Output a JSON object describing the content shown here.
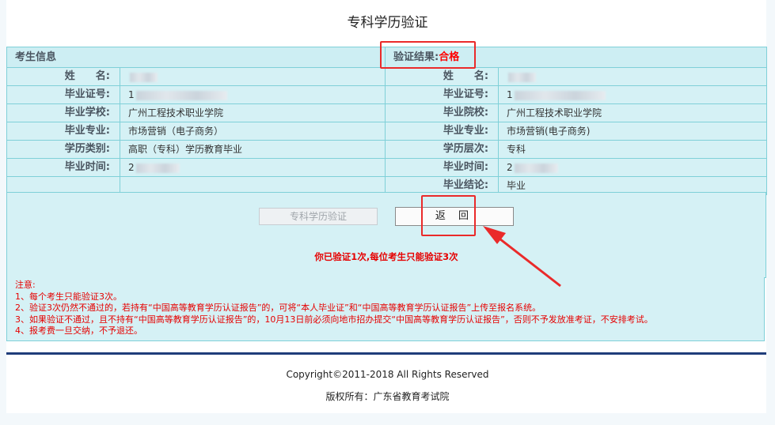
{
  "page": {
    "title": "专科学历验证"
  },
  "info": {
    "left_header": "考生信息",
    "right_header_label": "验证结果:",
    "right_header_value": "合格",
    "rows": [
      {
        "l_label": "姓　　名:",
        "l_value": "",
        "l_redacted": true,
        "r_label": "姓　　名:",
        "r_value": "",
        "r_redacted": true
      },
      {
        "l_label": "毕业证号:",
        "l_value": "1",
        "l_redacted": true,
        "r_label": "毕业证号:",
        "r_value": "1",
        "r_redacted": true
      },
      {
        "l_label": "毕业学校:",
        "l_value": "广州工程技术职业学院",
        "l_redacted": false,
        "r_label": "毕业院校:",
        "r_value": "广州工程技术职业学院",
        "r_redacted": false
      },
      {
        "l_label": "毕业专业:",
        "l_value": "市场营销（电子商务）",
        "l_redacted": false,
        "r_label": "毕业专业:",
        "r_value": "市场营销(电子商务)",
        "r_redacted": false
      },
      {
        "l_label": "学历类别:",
        "l_value": "高职（专科）学历教育毕业",
        "l_redacted": false,
        "r_label": "学历层次:",
        "r_value": "专科",
        "r_redacted": false
      },
      {
        "l_label": "毕业时间:",
        "l_value": "2",
        "l_redacted": true,
        "r_label": "毕业时间:",
        "r_value": "2",
        "r_redacted": true
      },
      {
        "l_label": "",
        "l_value": "",
        "l_redacted": false,
        "r_label": "毕业结论:",
        "r_value": "毕业",
        "r_redacted": false
      }
    ]
  },
  "actions": {
    "verify_label": "专科学历验证",
    "back_label": "返 回",
    "warning": "你已验证1次,每位考生只能验证3次"
  },
  "notes": {
    "title": "注意:",
    "items": [
      "1、每个考生只能验证3次。",
      "2、验证3次仍然不通过的，若持有“中国高等教育学历认证报告”的，可将“本人毕业证”和“中国高等教育学历认证报告”上传至报名系统。",
      "3、如果验证不通过，且不持有“中国高等教育学历认证报告”的，10月13日前必须向地市招办提交“中国高等教育学历认证报告”，否则不予发放准考证，不安排考试。",
      "4、报考费一旦交纳，不予退还。"
    ]
  },
  "footer": {
    "copyright": "Copyright©2011-2018 All Rights Reserved",
    "owner": "版权所有：广东省教育考试院"
  },
  "colors": {
    "highlight": "#ea2a2a",
    "table_bg": "#d5f1f5",
    "table_border": "#7fd0d8",
    "footer_bar": "#1f3d7a",
    "warning_text": "#e60000"
  }
}
